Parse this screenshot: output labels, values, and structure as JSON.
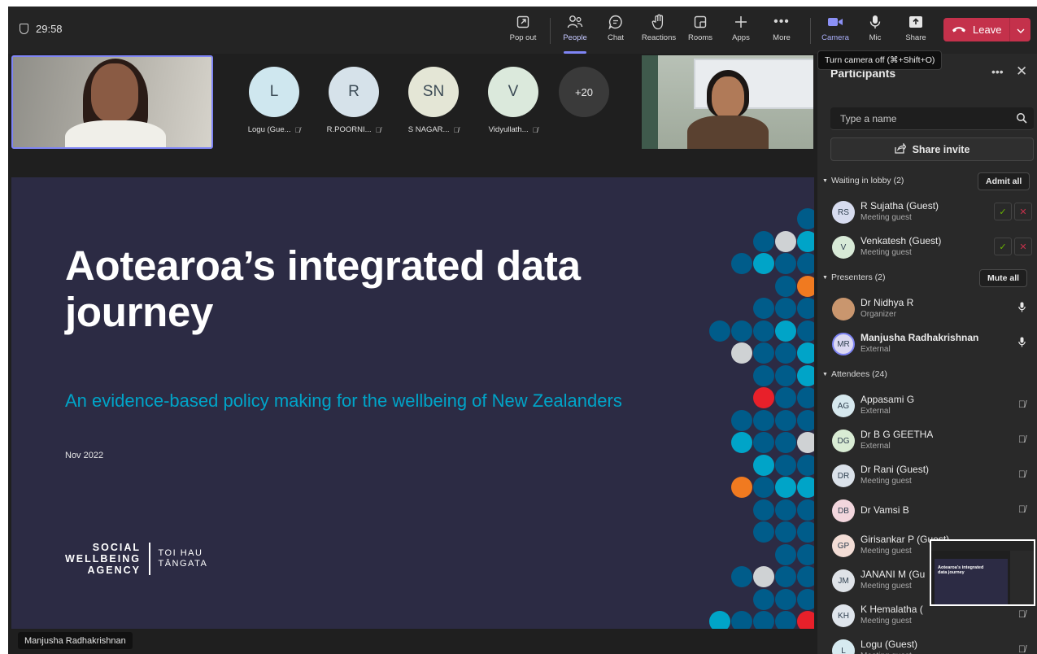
{
  "meeting": {
    "timer": "29:58"
  },
  "toolbar": {
    "popout": "Pop out",
    "people": "People",
    "chat": "Chat",
    "reactions": "Reactions",
    "rooms": "Rooms",
    "apps": "Apps",
    "more": "More",
    "camera": "Camera",
    "mic": "Mic",
    "share": "Share",
    "leave": "Leave"
  },
  "tooltip": "Turn camera off (⌘+Shift+O)",
  "gallery": {
    "tiles": [
      {
        "initials": "L",
        "name": "Logu (Gue...",
        "color": "#cfe7ef"
      },
      {
        "initials": "R",
        "name": "R.POORNI...",
        "color": "#d6e2ea"
      },
      {
        "initials": "SN",
        "name": "S NAGAR...",
        "color": "#e4e6d6"
      },
      {
        "initials": "V",
        "name": "Vidyullath...",
        "color": "#dbe9dc"
      }
    ],
    "overflow": "+20"
  },
  "slide": {
    "title": "Aotearoa’s integrated data journey",
    "subtitle": "An evidence-based policy making for the wellbeing of New Zealanders",
    "date": "Nov 2022",
    "logo_left": [
      "SOCIAL",
      "WELLBEING",
      "AGENCY"
    ],
    "logo_right": [
      "TOI HAU",
      "TĀNGATA"
    ],
    "presenter": "Manjusha Radhakrishnan",
    "dot_colors": {
      "dark": "#005c8a",
      "teal": "#00a4c8",
      "grey": "#cfd2d4",
      "orange": "#f07a20",
      "red": "#e8202a"
    }
  },
  "panel": {
    "title": "Participants",
    "search_placeholder": "Type a name",
    "share_invite": "Share invite",
    "lobby": {
      "label": "Waiting in lobby (2)",
      "action": "Admit all",
      "people": [
        {
          "initials": "RS",
          "name": "R Sujatha (Guest)",
          "role": "Meeting guest",
          "color": "#d7dcef"
        },
        {
          "initials": "V",
          "name": "Venkatesh (Guest)",
          "role": "Meeting guest",
          "color": "#d8ead7"
        }
      ]
    },
    "presenters": {
      "label": "Presenters (2)",
      "action": "Mute all",
      "people": [
        {
          "initials": "",
          "name": "Dr Nidhya R",
          "role": "Organizer",
          "color": "#c9966e"
        },
        {
          "initials": "MR",
          "name": "Manjusha Radhakrishnan",
          "role": "External",
          "color": "#dcd9f2"
        }
      ]
    },
    "attendees": {
      "label": "Attendees (24)",
      "people": [
        {
          "initials": "AG",
          "name": "Appasami G",
          "role": "External",
          "color": "#d6e8ee"
        },
        {
          "initials": "DG",
          "name": "Dr B G GEETHA",
          "role": "External",
          "color": "#d9ecd4"
        },
        {
          "initials": "DR",
          "name": "Dr Rani (Guest)",
          "role": "Meeting guest",
          "color": "#dbe2ea"
        },
        {
          "initials": "DB",
          "name": "Dr Vamsi B",
          "role": "",
          "color": "#f2d6dd"
        },
        {
          "initials": "GP",
          "name": "Girisankar P (Guest)",
          "role": "Meeting guest",
          "color": "#f3ddd6"
        },
        {
          "initials": "JM",
          "name": "JANANI M (Gu",
          "role": "Meeting guest",
          "color": "#dfe3e8"
        },
        {
          "initials": "KH",
          "name": "K Hemalatha (",
          "role": "Meeting guest",
          "color": "#dfe5ec"
        },
        {
          "initials": "L",
          "name": "Logu (Guest)",
          "role": "Meeting guest",
          "color": "#d6eaf0"
        }
      ]
    }
  }
}
